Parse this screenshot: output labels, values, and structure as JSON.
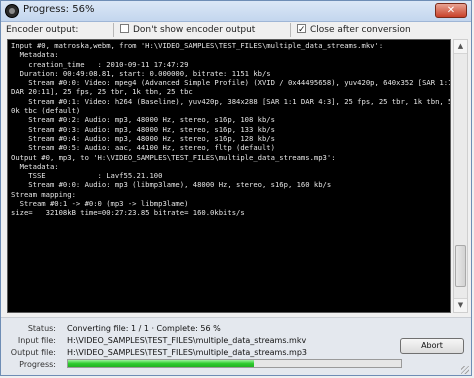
{
  "window": {
    "title": "Progress: 56%"
  },
  "options": {
    "encoder_output_label": "Encoder output:",
    "dont_show_label": "Don't show encoder output",
    "dont_show_checked": false,
    "close_after_label": "Close after conversion",
    "close_after_checked": true
  },
  "console": {
    "lines": [
      "Input #0, matroska,webm, from 'H:\\VIDEO_SAMPLES\\TEST_FILES\\multiple_data_streams.mkv':",
      "  Metadata:",
      "    creation_time   : 2010-09-11 17:47:29",
      "  Duration: 00:49:08.81, start: 0.000000, bitrate: 1151 kb/s",
      "    Stream #0:0: Video: mpeg4 (Advanced Simple Profile) (XVID / 0x44495658), yuv420p, 640x352 [SAR 1:1",
      "DAR 20:11], 25 fps, 25 tbr, 1k tbn, 25 tbc",
      "    Stream #0:1: Video: h264 (Baseline), yuv420p, 384x288 [SAR 1:1 DAR 4:3], 25 fps, 25 tbr, 1k tbn, 5",
      "0k tbc (default)",
      "    Stream #0:2: Audio: mp3, 48000 Hz, stereo, s16p, 108 kb/s",
      "    Stream #0:3: Audio: mp3, 48000 Hz, stereo, s16p, 133 kb/s",
      "    Stream #0:4: Audio: mp3, 48000 Hz, stereo, s16p, 128 kb/s",
      "    Stream #0:5: Audio: aac, 44100 Hz, stereo, fltp (default)",
      "Output #0, mp3, to 'H:\\VIDEO_SAMPLES\\TEST_FILES\\multiple_data_streams.mp3':",
      "  Metadata:",
      "    TSSE            : Lavf55.21.100",
      "    Stream #0:0: Audio: mp3 (libmp3lame), 48000 Hz, stereo, s16p, 160 kb/s",
      "Stream mapping:",
      "  Stream #0:1 -> #0:0 (mp3 -> libmp3lame)",
      "size=   32108kB time=00:27:23.85 bitrate= 160.0kbits/s"
    ]
  },
  "status": {
    "status_label": "Status:",
    "status_value": "Converting file: 1 / 1   ·   Complete: 56 %",
    "input_label": "Input file:",
    "input_value": "H:\\VIDEO_SAMPLES\\TEST_FILES\\multiple_data_streams.mkv",
    "output_label": "Output file:",
    "output_value": "H:\\VIDEO_SAMPLES\\TEST_FILES\\multiple_data_streams.mp3",
    "progress_label": "Progress:",
    "progress_percent": 56,
    "abort_label": "Abort"
  },
  "colors": {
    "progress_fill": "#2ecc2e",
    "console_bg": "#000000",
    "console_fg": "#e6e6e6"
  }
}
